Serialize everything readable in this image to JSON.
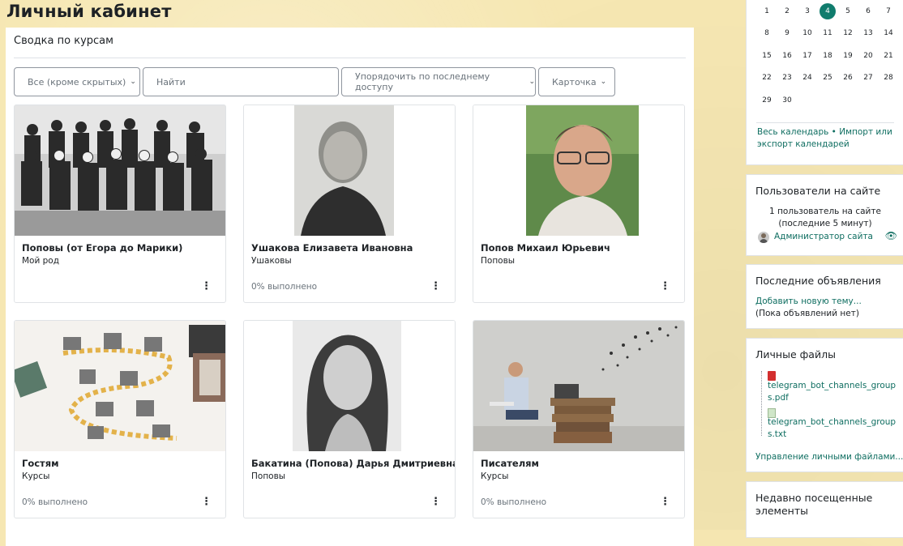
{
  "page_title": "Личный кабинет",
  "course_overview": {
    "title": "Сводка по курсам",
    "filter_label": "Все (кроме скрытых)",
    "search_placeholder": "Найти",
    "sort_label": "Упорядочить по последнему доступу",
    "view_label": "Карточка",
    "courses": [
      {
        "name": "Поповы (от Егора до Марики)",
        "category": "Мой род",
        "progress": "",
        "image": "group-photo"
      },
      {
        "name": "Ушакова Елизавета Ивановна",
        "category": "Ушаковы",
        "progress": "0% выполнено",
        "image": "portrait"
      },
      {
        "name": "Попов Михаил Юрьевич",
        "category": "Поповы",
        "progress": "",
        "image": "portrait"
      },
      {
        "name": "Гостям",
        "category": "Курсы",
        "progress": "0% выполнено",
        "image": "infographic"
      },
      {
        "name": "Бакатина (Попова) Дарья Дмитриевна",
        "category": "Поповы",
        "progress": "",
        "image": "portrait"
      },
      {
        "name": "Писателям",
        "category": "Курсы",
        "progress": "0% выполнено",
        "image": "writer"
      }
    ]
  },
  "calendar": {
    "today": "4",
    "rows": [
      [
        "1",
        "2",
        "3",
        "4",
        "5",
        "6",
        "7"
      ],
      [
        "8",
        "9",
        "10",
        "11",
        "12",
        "13",
        "14"
      ],
      [
        "15",
        "16",
        "17",
        "18",
        "19",
        "20",
        "21"
      ],
      [
        "22",
        "23",
        "24",
        "25",
        "26",
        "27",
        "28"
      ],
      [
        "29",
        "30"
      ]
    ],
    "full_link": "Весь календарь",
    "separator": "•",
    "import_link": "Импорт или экспорт календарей"
  },
  "online_users": {
    "title": "Пользователи на сайте",
    "count_text": "1 пользователь на сайте",
    "period_text": "(последние 5 минут)",
    "user_name": "Администратор сайта"
  },
  "news": {
    "title": "Последние объявления",
    "add_link": "Добавить новую тему...",
    "empty_text": "(Пока объявлений нет)"
  },
  "private_files": {
    "title": "Личные файлы",
    "files": [
      {
        "line1": "telegram_bot_channels_group",
        "line2": "s.pdf",
        "type": "pdf"
      },
      {
        "line1": "telegram_bot_channels_group",
        "line2": "s.txt",
        "type": "txt"
      }
    ],
    "manage_link": "Управление личными файлами..."
  },
  "recent_items": {
    "title_line1": "Недавно посещенные",
    "title_line2": "элементы"
  },
  "colors": {
    "accent": "#107c6d",
    "link": "#0f6e61",
    "page_bg": "#f6e7b2"
  }
}
